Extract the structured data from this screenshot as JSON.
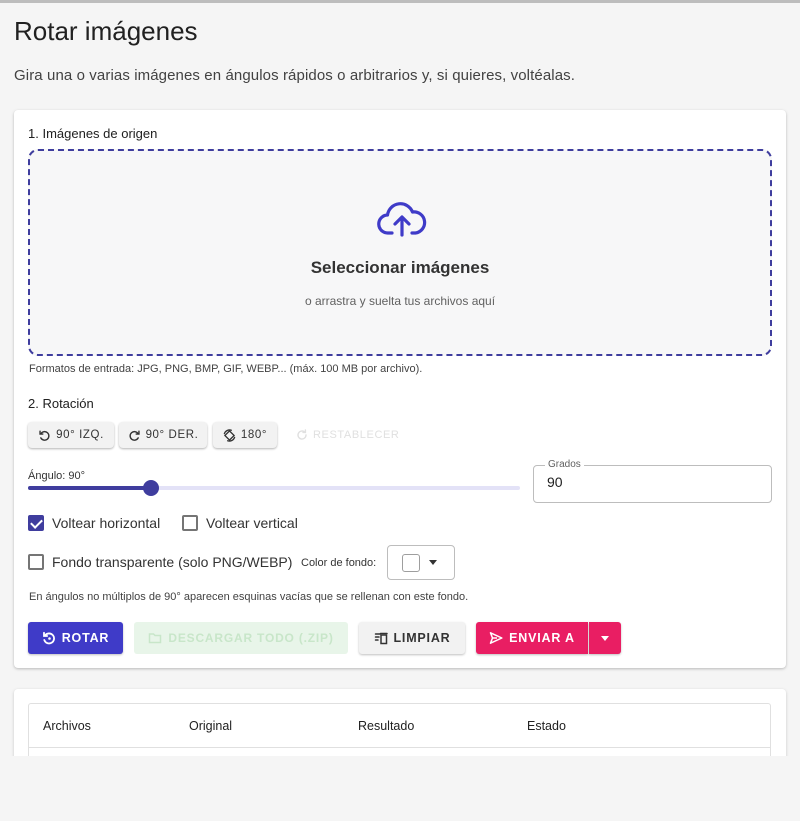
{
  "page": {
    "title": "Rotar imágenes",
    "subtitle": "Gira una o varias imágenes en ángulos rápidos o arbitrarios y, si quieres, voltéalas."
  },
  "source": {
    "section_label": "1. Imágenes de origen",
    "dropzone_title": "Seleccionar imágenes",
    "dropzone_subtitle": "o arrastra y suelta tus archivos aquí",
    "formats_note": "Formatos de entrada: JPG, PNG, BMP, GIF, WEBP... (máx. 100 MB por archivo)."
  },
  "rotation": {
    "section_label": "2. Rotación",
    "quick_buttons": {
      "left": "90° IZQ.",
      "right": "90° DER.",
      "flip": "180°",
      "reset": "RESTABLECER"
    },
    "angle_label": "Ángulo: 90°",
    "slider": {
      "value": 90,
      "min": 0,
      "max": 360
    },
    "degrees_field": {
      "label": "Grados",
      "value": "90"
    },
    "flip_horizontal": {
      "label": "Voltear horizontal",
      "checked": true
    },
    "flip_vertical": {
      "label": "Voltear vertical",
      "checked": false
    },
    "transparent_bg": {
      "label": "Fondo transparente (solo PNG/WEBP)",
      "checked": false
    },
    "bg_color_label": "Color de fondo:",
    "bg_color": "#ffffff",
    "note": "En ángulos no múltiplos de 90° aparecen esquinas vacías que se rellenan con este fondo."
  },
  "actions": {
    "rotate": "ROTAR",
    "download_zip": "DESCARGAR TODO (.ZIP)",
    "clear": "LIMPIAR",
    "send_to": "ENVIAR A"
  },
  "results_table": {
    "headers": [
      "Archivos",
      "Original",
      "Resultado",
      "Estado"
    ]
  },
  "colors": {
    "primary": "#3f3bc8",
    "accent": "#e91e63",
    "dropzone_border": "#3f3d9e",
    "zip_disabled_bg": "#e8f5e9"
  }
}
